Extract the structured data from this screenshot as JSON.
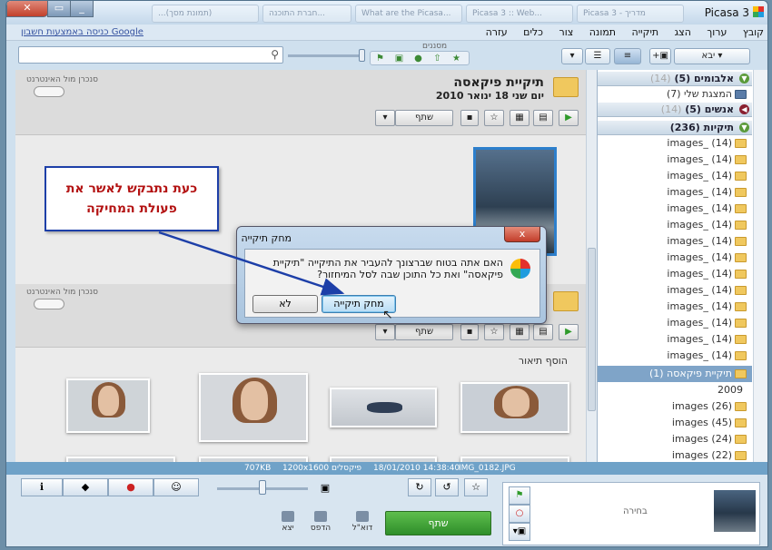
{
  "window": {
    "title": "Picasa 3",
    "ghost_tabs": [
      "...(תמונת מסך)",
      "חברת התוכנה...",
      "What are the Picasa...",
      "Picasa 3 :: Web...",
      "Picasa 3 - מדריך"
    ]
  },
  "menu": {
    "items": [
      "קובץ",
      "ערוך",
      "הצג",
      "תיקייה",
      "תמונה",
      "צור",
      "כלים",
      "עזרה"
    ],
    "google_signin": "כניסה באמצעות חשבון Google"
  },
  "toolbar": {
    "import_label": "יבא",
    "filters_label": "מסננים"
  },
  "sidebar": {
    "albums": "אלבומים (5)",
    "albums_count": "(14)",
    "my_show": "המצגת שלי (7)",
    "people": "אנשים (5)",
    "people_count": "(14)",
    "folders": "תיקיות (236)",
    "images_label": "images_",
    "images_count": "(14)",
    "selected_folder": "תיקיית פיקאסה (1)",
    "year": "2009",
    "year_rows": [
      "images (26)",
      "images (45)",
      "images (24)",
      "images (22)"
    ]
  },
  "main": {
    "folder1_name": "תיקיית פיקאסה",
    "folder1_date": "יום שני 18 ינואר 2010",
    "sync_label": "סנכרן מול האינטרנט",
    "share_label": "שתף",
    "add_caption": "הוסף תיאור"
  },
  "dialog": {
    "title": "מחק תיקייה",
    "message": "האם אתה בטוח שברצונך להעביר את התיקייה \"תיקיית פיקאסה\" ואת כל התוכן שבה לסל המיחזור?",
    "yes_label": "מחק תיקייה",
    "no_label": "לא",
    "close_glyph": "x"
  },
  "callout": {
    "text": "כעת נתבקש לאשר את פעולת המחיקה",
    "border_color": "#1d3fa8",
    "text_color": "#b31212"
  },
  "status": {
    "filename": "IMG_0182.JPG",
    "datetime": "18/01/2010 14:38:40",
    "dimensions": "1200x1600 פיקסלים",
    "size": "707KB"
  },
  "bottom": {
    "share_label": "שתף",
    "email_label": "דוא\"ל",
    "print_label": "הדפס",
    "export_label": "יצא",
    "selection_label": "בחירה"
  }
}
